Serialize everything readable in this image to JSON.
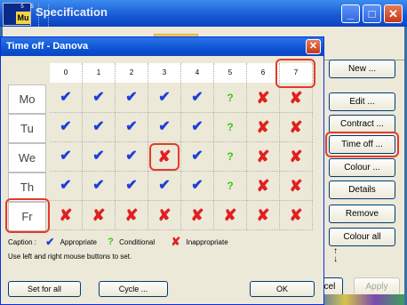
{
  "outer_window": {
    "title": "Specification",
    "icon_text": {
      "s1": "5",
      "s2": "5",
      "badge": "Mu"
    },
    "controls": {
      "minimize": "_",
      "maximize": "□",
      "close": "✕"
    }
  },
  "right_buttons": [
    {
      "label": "New ..."
    },
    {
      "label": "Edit ..."
    },
    {
      "label": "Contract ..."
    },
    {
      "label": "Time off ..."
    },
    {
      "label": "Colour ..."
    },
    {
      "label": "Details"
    },
    {
      "label": "Remove"
    },
    {
      "label": "Colour all"
    }
  ],
  "bottom_buttons": {
    "cancel_partial": "cel",
    "apply": "Apply"
  },
  "arrows": {
    "up": "↑",
    "down": "↓"
  },
  "dialog": {
    "title": "Time off - Danova",
    "close_label": "✕",
    "periods": [
      "0",
      "1",
      "2",
      "3",
      "4",
      "5",
      "6",
      "7"
    ],
    "rows": [
      {
        "day": "Mo",
        "cells": [
          "tick",
          "tick",
          "tick",
          "tick",
          "tick",
          "cond",
          "cross",
          "cross"
        ]
      },
      {
        "day": "Tu",
        "cells": [
          "tick",
          "tick",
          "tick",
          "tick",
          "tick",
          "cond",
          "cross",
          "cross"
        ]
      },
      {
        "day": "We",
        "cells": [
          "tick",
          "tick",
          "tick",
          "cross",
          "tick",
          "cond",
          "cross",
          "cross"
        ]
      },
      {
        "day": "Th",
        "cells": [
          "tick",
          "tick",
          "tick",
          "tick",
          "tick",
          "cond",
          "cross",
          "cross"
        ]
      },
      {
        "day": "Fr",
        "cells": [
          "cross",
          "cross",
          "cross",
          "cross",
          "cross",
          "cross",
          "cross",
          "cross"
        ]
      }
    ],
    "caption_label": "Caption :",
    "legend": {
      "appropriate": "Appropriate",
      "conditional": "Conditional",
      "inappropriate": "Inappropriate"
    },
    "hint": "Use left and right mouse buttons to set.",
    "buttons": {
      "set_for_all": "Set for all",
      "cycle": "Cycle ...",
      "ok": "OK"
    }
  },
  "colors": {
    "tick": "#1c3fd6",
    "cross": "#e02020",
    "cond": "#39c81a",
    "highlight": "#e33a2a"
  }
}
